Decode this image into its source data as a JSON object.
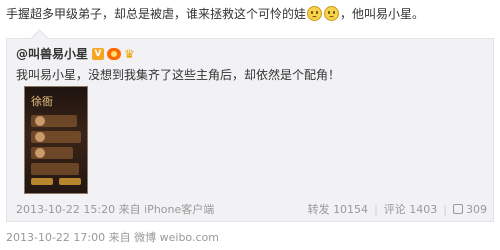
{
  "post": {
    "text_main": "手握超多甲级弟子，却总是被虐，谁来拯救这个可怜的娃",
    "emoji_icons": [
      "sad-face",
      "sad-face"
    ],
    "text_tail": "，他叫易小星。"
  },
  "repost": {
    "author": "@叫兽易小星",
    "badge_verified": "V",
    "text": "我叫易小星，没想到我集齐了这些主角后，却依然是个配角！",
    "image_title": "徐衙",
    "timestamp": "2013-10-22 15:20",
    "source_prefix": "来自",
    "source": "iPhone客户端",
    "repost_label": "转发",
    "repost_count": "10154",
    "comment_label": "评论",
    "comment_count": "1403",
    "like_count": "309"
  },
  "footer": {
    "timestamp": "2013-10-22 17:00",
    "source_prefix": "来自",
    "source": "微博 weibo.com"
  },
  "colors": {
    "text": "#333333",
    "meta": "#999999",
    "repost_bg": "#f2f2f5",
    "verified": "#f5a623"
  }
}
